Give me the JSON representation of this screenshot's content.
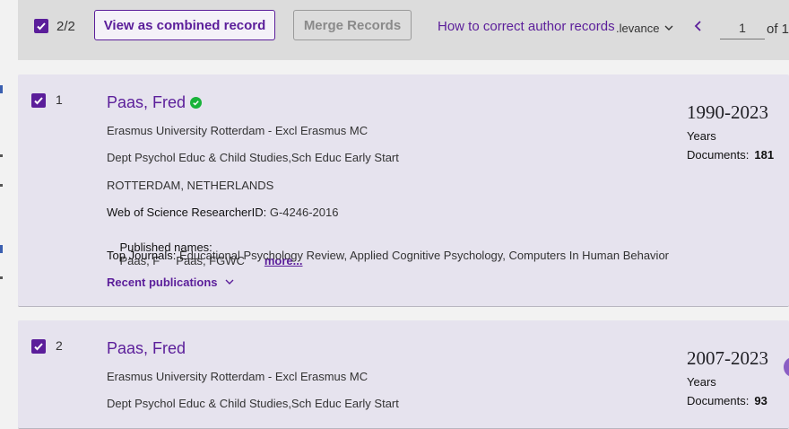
{
  "toolbar": {
    "selected_count": "2/2",
    "view_combined_label": "View as combined record",
    "merge_label": "Merge Records",
    "help_link": "How to correct author records",
    "sort_label": ".levance",
    "prev_icon": "chevron-left-icon",
    "page_value": "1",
    "page_of": "of 1"
  },
  "colors": {
    "accent": "#5b1e9a",
    "verified": "#19b33a",
    "card_bg": "#e6e3ee",
    "toolbar_bg": "#dcdcdc"
  },
  "records": [
    {
      "index": "1",
      "name": "Paas, Fred",
      "verified": true,
      "affiliation": "Erasmus University Rotterdam - Excl Erasmus MC",
      "department": "Dept Psychol Educ & Child Studies,Sch Educ Early Start",
      "location": "ROTTERDAM, NETHERLANDS",
      "researcher_id_label": "Web of Science ResearcherID:",
      "researcher_id": "G-4246-2016",
      "published_names_label": "Published names:",
      "published_names": "Paas, F     Paas, FGWC",
      "more_label": "more...",
      "top_journals_label": "Top Journals:",
      "top_journals": "Educational Psychology Review, Applied Cognitive Psychology, Computers In Human Behavior",
      "recent_label": "Recent publications",
      "years": "1990-2023",
      "years_label": "Years",
      "documents_label": "Documents:",
      "documents": "181"
    },
    {
      "index": "2",
      "name": "Paas, Fred",
      "verified": false,
      "affiliation": "Erasmus University Rotterdam - Excl Erasmus MC",
      "department": "Dept Psychol Educ & Child Studies,Sch Educ Early Start",
      "years": "2007-2023",
      "years_label": "Years",
      "documents_label": "Documents:",
      "documents": "93"
    }
  ]
}
